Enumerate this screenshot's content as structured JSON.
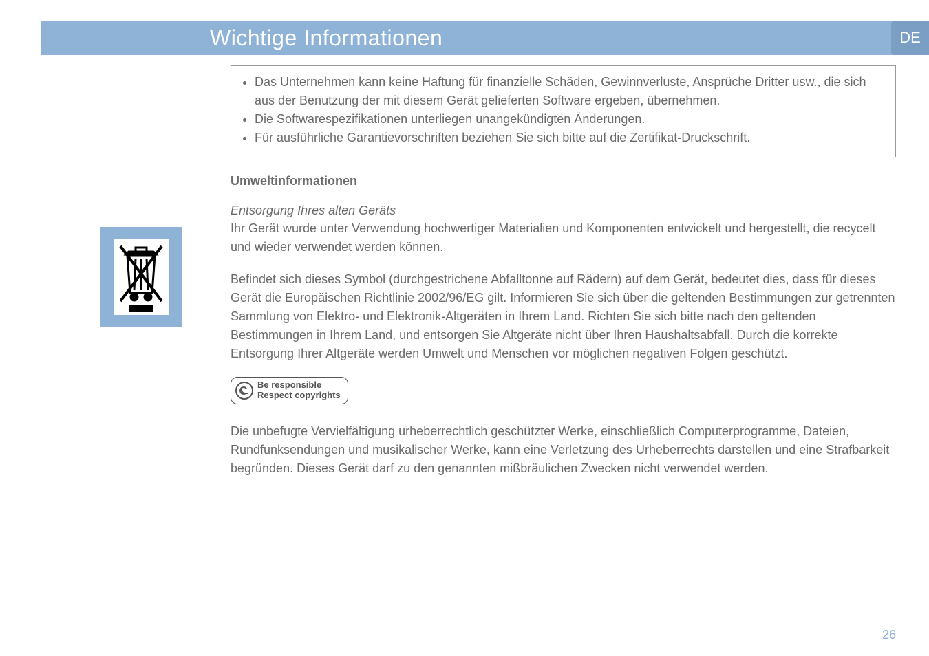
{
  "header": {
    "title": "Wichtige Informationen",
    "lang": "DE"
  },
  "box": {
    "b1": "Das Unternehmen kann keine Haftung für finanzielle Schäden, Gewinnverluste, Ansprüche Dritter usw., die sich aus der Benutzung der mit diesem Gerät gelieferten Software ergeben, übernehmen.",
    "b2": "Die Softwarespezifikationen unterliegen unangekündigten Änderungen.",
    "b3": "Für ausführliche Garantievorschriften beziehen Sie sich bitte auf die Zertifikat-Druckschrift."
  },
  "section_heading": "Umweltinformationen",
  "subhead": "Entsorgung Ihres alten Geräts",
  "para1": "Ihr Gerät wurde unter Verwendung hochwertiger Materialien und Komponenten entwickelt und hergestellt, die recycelt und wieder verwendet werden können.",
  "para2": "Befindet sich dieses Symbol (durchgestrichene Abfalltonne auf Rädern) auf dem Gerät, bedeutet dies, dass für dieses Gerät die Europäischen Richtlinie 2002/96/EG gilt. Informieren Sie sich über die geltenden Bestimmungen zur getrennten Sammlung von Elektro- und Elektronik-Altgeräten in Ihrem Land. Richten Sie sich bitte nach den geltenden Bestimmungen in Ihrem Land, und entsorgen Sie Altgeräte nicht über Ihren Haushaltsabfall. Durch die korrekte Entsorgung Ihrer Altgeräte werden Umwelt und Menschen vor möglichen negativen Folgen geschützt.",
  "copy": {
    "l1": "Be responsible",
    "l2": "Respect copyrights"
  },
  "para3": "Die unbefugte Vervielfältigung urheberrechtlich geschützter Werke, einschließlich Computerprogramme, Dateien, Rundfunksendungen und musikalischer Werke, kann eine Verletzung des Urheberrechts darstellen und eine Strafbarkeit begründen. Dieses Gerät darf zu den genannten mißbräulichen Zwecken nicht verwendet werden.",
  "page": "26"
}
